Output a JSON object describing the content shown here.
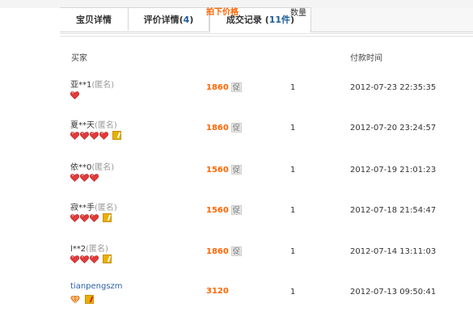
{
  "tabs": [
    {
      "label": "宝贝详情",
      "count": ""
    },
    {
      "label": "评价详情",
      "count": "4"
    },
    {
      "label": "成交记录",
      "count": "11件"
    }
  ],
  "columns": {
    "buyer": "买家",
    "price": "拍下价格",
    "qty": "数量",
    "time": "付款时间"
  },
  "promo_label": "促",
  "anon_label": "(匿名)",
  "rows": [
    {
      "buyer": "亚**1",
      "anon": true,
      "hearts": 1,
      "vip": false,
      "price": "1860",
      "promo": true,
      "qty": "1",
      "time": "2012-07-23 22:35:35"
    },
    {
      "buyer": "夏**天",
      "anon": true,
      "hearts": 4,
      "vip": true,
      "price": "1860",
      "promo": true,
      "qty": "1",
      "time": "2012-07-20 23:24:57"
    },
    {
      "buyer": "依**0",
      "anon": true,
      "hearts": 3,
      "vip": false,
      "price": "1560",
      "promo": true,
      "qty": "1",
      "time": "2012-07-19 21:01:23"
    },
    {
      "buyer": "寂**手",
      "anon": true,
      "hearts": 3,
      "vip": true,
      "price": "1560",
      "promo": true,
      "qty": "1",
      "time": "2012-07-18 21:54:47"
    },
    {
      "buyer": "l**2",
      "anon": true,
      "hearts": 3,
      "vip": true,
      "price": "1860",
      "promo": true,
      "qty": "1",
      "time": "2012-07-14 13:11:03"
    },
    {
      "buyer": "tianpengszm",
      "anon": false,
      "hearts": 0,
      "diamond": true,
      "vip": true,
      "price": "3120",
      "promo": false,
      "qty": "1",
      "time": "2012-07-13 09:50:41"
    }
  ],
  "colors": {
    "price": "#ff6600",
    "link": "#2b5fa8",
    "heart": "#e23b3b",
    "vip": "#e8b000"
  },
  "icons": {
    "heart": "heart-icon",
    "diamond": "diamond-icon",
    "vip": "vip-badge-icon"
  }
}
